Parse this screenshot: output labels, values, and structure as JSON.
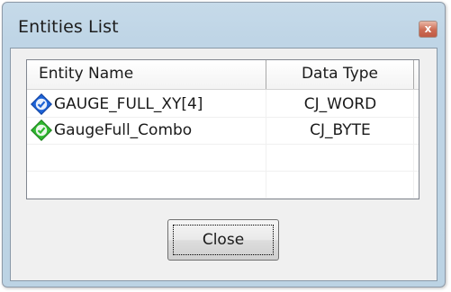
{
  "window": {
    "title": "Entities List",
    "close_glyph": "x"
  },
  "list": {
    "columns": [
      "Entity Name",
      "Data Type"
    ],
    "rows": [
      {
        "name": "GAUGE_FULL_XY[4]",
        "type": "CJ_WORD",
        "icon": "blue-entity-icon"
      },
      {
        "name": "GaugeFull_Combo",
        "type": "CJ_BYTE",
        "icon": "green-entity-icon"
      }
    ]
  },
  "buttons": {
    "close_label": "Close"
  },
  "colors": {
    "title_bar": "#bfd5e6",
    "client_bg": "#f0f0f0",
    "close_x_red": "#cc6b53",
    "icon_blue": "#1e63d6",
    "icon_green": "#2fb82f"
  }
}
